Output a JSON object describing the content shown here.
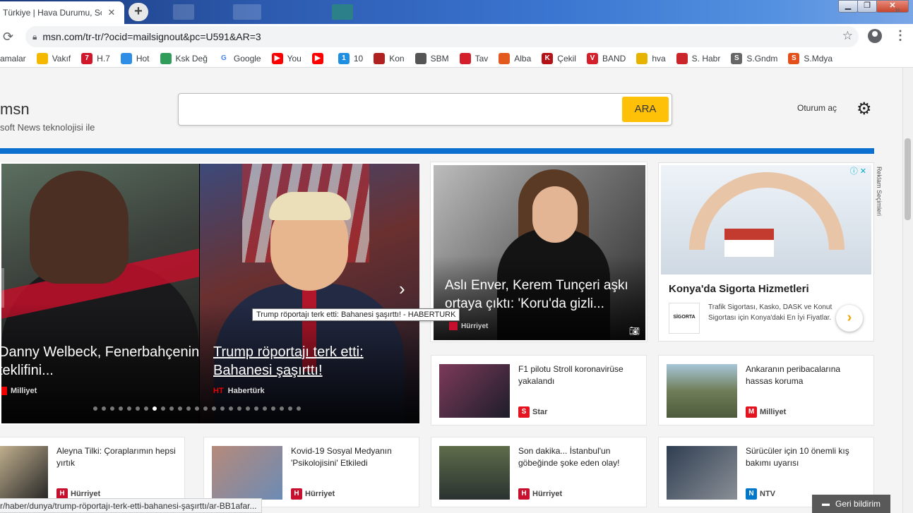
{
  "browser": {
    "tab_title": "Türkiye | Hava Durumu, Son",
    "tab_close": "✕",
    "new_tab": "+",
    "window_min": "▁",
    "window_max": "❐",
    "window_close": "✕",
    "url": "msn.com/tr-tr/?ocid=mailsignout&pc=U591&AR=3",
    "bookmarks": [
      {
        "label": "amalar",
        "icon": "bookmark-icon",
        "color": "#ffffff",
        "glyph": ""
      },
      {
        "label": "Vakıf",
        "icon": "vakif-icon",
        "color": "#f5b800",
        "glyph": ""
      },
      {
        "label": "H.7",
        "icon": "h7-icon",
        "color": "#d0182a",
        "glyph": "7"
      },
      {
        "label": "Hot",
        "icon": "microsoft-icon",
        "color": "#2f8ee6",
        "glyph": ""
      },
      {
        "label": "Ksk Değ",
        "icon": "globe-icon",
        "color": "#2f9c5a",
        "glyph": ""
      },
      {
        "label": "Google",
        "icon": "google-icon",
        "color": "#ffffff",
        "glyph": "G"
      },
      {
        "label": "You",
        "icon": "youtube-icon",
        "color": "#ff0000",
        "glyph": "▶"
      },
      {
        "label": "",
        "icon": "youtube-icon",
        "color": "#ff0000",
        "glyph": "▶"
      },
      {
        "label": "10",
        "icon": "ten-icon",
        "color": "#1d8ee0",
        "glyph": "1"
      },
      {
        "label": "Kon",
        "icon": "news-icon",
        "color": "#b0221f",
        "glyph": ""
      },
      {
        "label": "SBM",
        "icon": "sbm-icon",
        "color": "#555555",
        "glyph": ""
      },
      {
        "label": "Tav",
        "icon": "tav-icon",
        "color": "#d21f2b",
        "glyph": ""
      },
      {
        "label": "Alba",
        "icon": "alba-icon",
        "color": "#e35a1f",
        "glyph": ""
      },
      {
        "label": "Çekil",
        "icon": "kh-icon",
        "color": "#b31217",
        "glyph": "K"
      },
      {
        "label": "BAND",
        "icon": "band-icon",
        "color": "#d3202a",
        "glyph": "V"
      },
      {
        "label": "hva",
        "icon": "hva-icon",
        "color": "#e6b400",
        "glyph": ""
      },
      {
        "label": "S. Habr",
        "icon": "habr-icon",
        "color": "#c9252b",
        "glyph": ""
      },
      {
        "label": "S.Gndm",
        "icon": "sg-icon",
        "color": "#666666",
        "glyph": "S"
      },
      {
        "label": "S.Mdya",
        "icon": "smdya-icon",
        "color": "#e4501c",
        "glyph": "S"
      }
    ],
    "bookmarks_more": "»"
  },
  "header": {
    "logo": "msn",
    "logo_sub": "soft News teknolojisi ile",
    "search_button": "ARA",
    "search_placeholder": "",
    "signin": "Oturum aç"
  },
  "carousel": {
    "slides": [
      {
        "title": "Danny Welbeck, Fenerbahçenin teklifini...",
        "source": "Milliyet"
      },
      {
        "title": "Trump röportajı terk etti: Bahanesi şaşırttı!",
        "source": "Habertürk",
        "source_abbr": "HT"
      }
    ],
    "dot_count": 25,
    "active_dot": 7,
    "next_label": "›"
  },
  "tooltip": "Trump röportajı terk etti: Bahanesi şaşırttı! - HABERTURK",
  "feature": {
    "title": "Aslı Enver, Kerem Tunçeri aşkı ortaya çıktı: 'Koru'da gizli...",
    "source": "Hürriyet"
  },
  "ad": {
    "title": "Konya'da Sigorta Hizmetleri",
    "logo_text": "SİGORTA",
    "text": "Trafik Sigortası, Kasko, DASK ve Konut Sigortası için Konya'daki En İyi Fiyatlar.",
    "choices": "Reklam Seçimleri",
    "info": "ⓘ ✕",
    "arrow": "›"
  },
  "cards": [
    {
      "title": "F1 pilotu Stroll koronavirüse yakalandı",
      "source": "Star",
      "badge": "S",
      "badge_color": "#e3141f",
      "thumb": "linear-gradient(135deg,#7c3a5a,#1d1d2a)"
    },
    {
      "title": "Ankaranın peribacalarına hassas koruma",
      "source": "Milliyet",
      "badge": "M",
      "badge_color": "#e3141f",
      "thumb": "linear-gradient(180deg,#a7c7d9,#6f7d58 50%,#4e5a3c)"
    },
    {
      "title": "Aleyna Tilki: Çoraplarımın hepsi yırtık",
      "source": "Hürriyet",
      "badge": "H",
      "badge_color": "#c8102e",
      "thumb": "linear-gradient(135deg,#e2cda5,#262626)"
    },
    {
      "title": "Kovid-19 Sosyal Medyanın 'Psikolojisini' Etkiledi",
      "source": "Hürriyet",
      "badge": "H",
      "badge_color": "#c8102e",
      "thumb": "linear-gradient(135deg,#b68a7a,#6c8bb5)"
    },
    {
      "title": "Son dakika... İstanbul'un göbeğinde şoke eden olay!",
      "source": "Hürriyet",
      "badge": "H",
      "badge_color": "#c8102e",
      "thumb": "linear-gradient(180deg,#5e6c4a,#2b3230)"
    },
    {
      "title": "Sürücüler için 10 önemli kış bakımı uyarısı",
      "source": "NTV",
      "badge": "N",
      "badge_color": "#0077c8",
      "thumb": "linear-gradient(135deg,#2f3e52,#8a8f96)"
    }
  ],
  "status_url": "r/haber/dunya/trump-röportajı-terk-etti-bahanesi-şaşırttı/ar-BB1afar...",
  "feedback": "Geri bildirim"
}
